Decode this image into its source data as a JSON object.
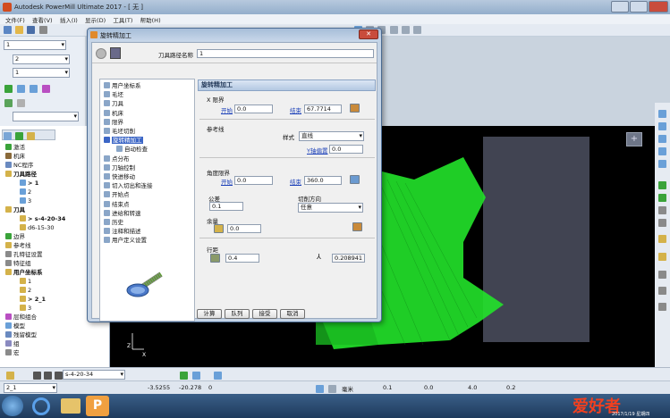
{
  "app": {
    "title": "Autodesk PowerMill Ultimate 2017 - [ 无 ]"
  },
  "menu": [
    "文件(F)",
    "查看(V)",
    "插入(I)",
    "显示(D)",
    "工具(T)",
    "帮助(H)"
  ],
  "left_toolbar": {
    "combo1": "1",
    "combo2": "2",
    "combo3": "1"
  },
  "explorer": {
    "items": [
      {
        "label": "激活",
        "indent": 0
      },
      {
        "label": "机床",
        "indent": 0
      },
      {
        "label": "NC程序",
        "indent": 0
      },
      {
        "label": "刀具路径",
        "indent": 0,
        "bold": true
      },
      {
        "label": "> 1",
        "indent": 1,
        "bold": true
      },
      {
        "label": "2",
        "indent": 1
      },
      {
        "label": "3",
        "indent": 1
      },
      {
        "label": "刀具",
        "indent": 0,
        "bold": true
      },
      {
        "label": "> s-4-20-34",
        "indent": 1,
        "bold": true
      },
      {
        "label": "d6-15-30",
        "indent": 1
      },
      {
        "label": "边界",
        "indent": 0
      },
      {
        "label": "参考线",
        "indent": 0
      },
      {
        "label": "孔特征设置",
        "indent": 0
      },
      {
        "label": "特征组",
        "indent": 0
      },
      {
        "label": "用户坐标系",
        "indent": 0,
        "bold": true
      },
      {
        "label": "1",
        "indent": 1
      },
      {
        "label": "2",
        "indent": 1
      },
      {
        "label": "> 2_1",
        "indent": 1,
        "bold": true
      },
      {
        "label": "3",
        "indent": 1
      },
      {
        "label": "层和组合",
        "indent": 0
      },
      {
        "label": "模型",
        "indent": 0
      },
      {
        "label": "残留模型",
        "indent": 0
      },
      {
        "label": "组",
        "indent": 0
      },
      {
        "label": "宏",
        "indent": 0
      }
    ]
  },
  "dialog": {
    "title": "旋转精加工",
    "toolpath_name_label": "刀具路径名称",
    "toolpath_name": "1",
    "tree": [
      {
        "label": "用户坐标系",
        "indent": 0
      },
      {
        "label": "毛坯",
        "indent": 0
      },
      {
        "label": "刀具",
        "indent": 0
      },
      {
        "label": "机床",
        "indent": 0
      },
      {
        "label": "限界",
        "indent": 0
      },
      {
        "label": "毛坯切削",
        "indent": 0
      },
      {
        "label": "旋转精加工",
        "indent": 0,
        "selected": true
      },
      {
        "label": "自动检查",
        "indent": 1
      },
      {
        "label": "点分布",
        "indent": 0
      },
      {
        "label": "刀轴控制",
        "indent": 0
      },
      {
        "label": "快进移动",
        "indent": 0
      },
      {
        "label": "切入切出和连接",
        "indent": 0
      },
      {
        "label": "开始点",
        "indent": 0
      },
      {
        "label": "结束点",
        "indent": 0
      },
      {
        "label": "进给和转速",
        "indent": 0
      },
      {
        "label": "历史",
        "indent": 0
      },
      {
        "label": "注释和描述",
        "indent": 0
      },
      {
        "label": "用户定义设置",
        "indent": 0
      }
    ],
    "panel_title": "旋转精加工",
    "x_limit": {
      "label": "X 限界",
      "start_label": "开始",
      "start": "0.0",
      "end_label": "结束",
      "end": "67.7714"
    },
    "ref_line": {
      "label": "参考线",
      "style_label": "样式",
      "style": "直线",
      "y_offset_label": "Y轴偏置",
      "y_offset": "0.0"
    },
    "angle_limit": {
      "label": "角度限界",
      "start_label": "开始",
      "start": "0.0",
      "end_label": "结束",
      "end": "360.0"
    },
    "tolerance": {
      "label": "公差",
      "value": "0.1"
    },
    "cut_direction": {
      "label": "切削方向",
      "value": "任意"
    },
    "allowance": {
      "label": "余量",
      "value": "0.0"
    },
    "stepover": {
      "label": "行距",
      "value": "0.4",
      "scallop": "0.208941"
    },
    "buttons": {
      "calculate": "计算",
      "queue": "队列",
      "accept": "接受",
      "cancel": "取消"
    }
  },
  "bottom": {
    "tool_name": "s-4-20-34",
    "ucs": "2_1",
    "x": "-3.5255",
    "y": "-20.278",
    "z": "0",
    "units": "毫米",
    "v1": "0.1",
    "v2": "0.0",
    "v3": "4.0",
    "v4": "0.2"
  },
  "taskbar": {
    "date": "2017/1/19 星期四",
    "watermark": "爱好者"
  },
  "colors": {
    "accent": "#3c66c6",
    "toolpath": "#22e32a",
    "viewport_bg": "#000000"
  }
}
